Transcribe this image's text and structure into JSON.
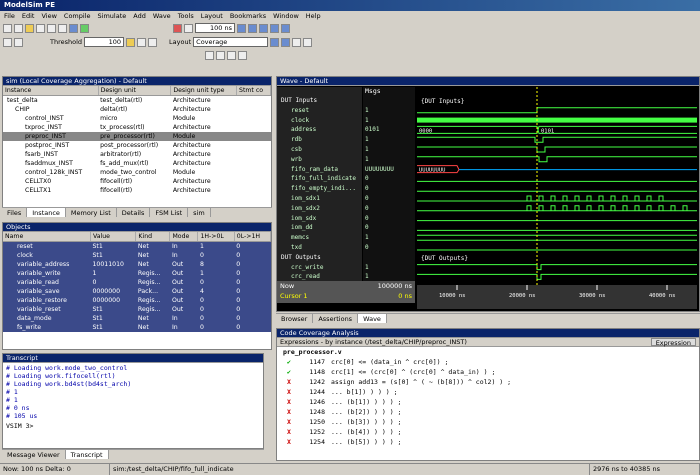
{
  "app": {
    "title": "ModelSim PE"
  },
  "menu": [
    "File",
    "Edit",
    "View",
    "Compile",
    "Simulate",
    "Add",
    "Wave",
    "Tools",
    "Layout",
    "Bookmarks",
    "Window",
    "Help"
  ],
  "toolbar": {
    "threshold_label": "Threshold",
    "threshold_value": "100",
    "layout_label": "Layout",
    "layout_value": "Coverage",
    "runlength": "100 ns"
  },
  "sim": {
    "title": "sim (Local Coverage Aggregation) - Default",
    "columns": [
      "Instance",
      "Design unit",
      "Design unit type",
      "Stmt co"
    ],
    "rows": [
      [
        "test_delta",
        "test_delta(rtl)",
        "Architecture"
      ],
      [
        "CHIP",
        "delta(rtl)",
        "Architecture"
      ],
      [
        "control_INST",
        "micro",
        "Module"
      ],
      [
        "txproc_INST",
        "tx_process(rtl)",
        "Architecture"
      ],
      [
        "preproc_INST",
        "pre_processor(rtl)",
        "Module"
      ],
      [
        "postproc_INST",
        "post_processor(rtl)",
        "Architecture"
      ],
      [
        "fsarb_INST",
        "arbitrator(rtl)",
        "Architecture"
      ],
      [
        "fsaddmux_INST",
        "fs_add_mux(rtl)",
        "Architecture"
      ],
      [
        "control_128k_INST",
        "mode_two_control",
        "Module"
      ],
      [
        "CELLTX0",
        "fifocell(rtl)",
        "Architecture"
      ],
      [
        "CELLTX1",
        "fifocell(rtl)",
        "Architecture"
      ]
    ],
    "tabs": [
      "Files",
      "Instance",
      "Memory List",
      "Details",
      "FSM List",
      "sim"
    ]
  },
  "objects": {
    "title": "Objects",
    "columns": [
      "Name",
      "Value",
      "Kind",
      "Mode",
      "1H->0L",
      "0L->1H"
    ],
    "rows": [
      [
        "reset",
        "St1",
        "Net",
        "In",
        "1",
        "0"
      ],
      [
        "clock",
        "St1",
        "Net",
        "In",
        "0",
        "0"
      ],
      [
        "variable_address",
        "10011010",
        "Net",
        "Out",
        "8",
        "0"
      ],
      [
        "variable_write",
        "1",
        "Regis...",
        "Out",
        "1",
        "0"
      ],
      [
        "variable_read",
        "0",
        "Regis...",
        "Out",
        "0",
        "0"
      ],
      [
        "variable_save",
        "0000000",
        "Pack...",
        "Out",
        "4",
        "0"
      ],
      [
        "variable_restore",
        "0000000",
        "Regis...",
        "Out",
        "0",
        "0"
      ],
      [
        "variable_reset",
        "St1",
        "Regis...",
        "Out",
        "0",
        "0"
      ],
      [
        "data_mode",
        "St1",
        "Net",
        "In",
        "0",
        "0"
      ],
      [
        "fs_write",
        "St1",
        "Net",
        "In",
        "0",
        "0"
      ]
    ]
  },
  "transcript": {
    "title": "Transcript",
    "lines": [
      "# Loading work.mode_two_control",
      "# Loading work.fifocell(rtl)",
      "# Loading work.bd4st(bd4st_arch)",
      "# 1",
      "# 1",
      "# 0 ns",
      "# 105 us"
    ],
    "prompt": "VSIM 3>",
    "tabs": [
      "Message Viewer",
      "Transcript"
    ]
  },
  "wave": {
    "title": "Wave - Default",
    "msgs_label": "Msgs",
    "signals": [
      [
        "DUT Inputs",
        ""
      ],
      [
        "reset",
        "1"
      ],
      [
        "clock",
        "1"
      ],
      [
        "address",
        "0101"
      ],
      [
        "rdb",
        "1"
      ],
      [
        "csb",
        "1"
      ],
      [
        "wrb",
        "1"
      ],
      [
        "fifo_ram_data",
        "UUUUUUUU"
      ],
      [
        "fifo_full_indicate",
        "0"
      ],
      [
        "fifo_empty_indi...",
        "0"
      ],
      [
        "iom_sdx1",
        "0"
      ],
      [
        "iom_sdx2",
        "0"
      ],
      [
        "iom_sdx",
        "0"
      ],
      [
        "iom_dd",
        "0"
      ],
      [
        "memcs",
        "1"
      ],
      [
        "txd",
        "0"
      ],
      [
        "DUT Outputs",
        ""
      ],
      [
        "crc_write",
        "1"
      ],
      [
        "crc_read",
        "1"
      ]
    ],
    "now_label": "Now",
    "now_value": "100000 ns",
    "cursor_label": "Cursor 1",
    "cursor_value": "0 ns",
    "labels": {
      "inputs": "{DUT Inputs}",
      "outputs": "{DUT Outputs}",
      "addr0": "0000",
      "addr1": "0101",
      "fifo": "UUUUUUUU"
    },
    "ticks": [
      "10000 ns",
      "20000 ns",
      "30000 ns",
      "40000 ns"
    ],
    "tabs": [
      "Browser",
      "Assertions",
      "Wave"
    ]
  },
  "coverage": {
    "title": "Code Coverage Analysis",
    "subtitle": "Expressions - by instance (/test_delta/CHIP/preproc_INST)",
    "expr_btn": "Expression",
    "file": "pre_processor.v",
    "lines": [
      [
        "ok",
        "1147",
        "crc[0] <=  (data_in ^ crc[0]) ;"
      ],
      [
        "ok",
        "1148",
        "crc[1] <=  (crc[0] ^ (crc[0] ^ data_in) ) ;"
      ],
      [
        "x",
        "1242",
        "assign add13 =  (s[0] ^ ( ~ (b[8])) ^ col2) ) ;"
      ],
      [
        "x",
        "1244",
        "... b[1]) ) ) ) ;"
      ],
      [
        "x",
        "1246",
        "... (b[1]) ) ) ) ;"
      ],
      [
        "x",
        "1248",
        "... (b[2]) ) ) ) ;"
      ],
      [
        "x",
        "1250",
        "... (b[3]) ) ) ) ;"
      ],
      [
        "x",
        "1252",
        "... (b[4]) ) ) ) ;"
      ],
      [
        "x",
        "1254",
        "... (b[5]) ) ) ) ;"
      ]
    ]
  },
  "status": {
    "now": "Now: 100 ns  Delta: 0",
    "path": "sim:/test_delta/CHIP/fifo_full_indicate",
    "range": "2976 ns to 40385 ns"
  },
  "colors": {
    "title": "#0a246a",
    "wave_bg": "#000000",
    "wave_sig": "#44ff44"
  }
}
